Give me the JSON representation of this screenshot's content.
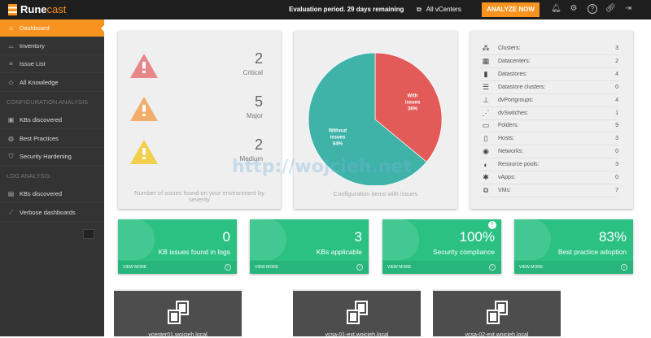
{
  "header": {
    "brand_a": "Rune",
    "brand_b": "cast",
    "evaluation": "Evaluation period. 29 days remaining",
    "vcenter_selector": "All vCenters",
    "analyze_label": "ANALYZE NOW",
    "icons": [
      "bell-icon",
      "gear-icon",
      "help-icon",
      "link-icon",
      "logout-icon"
    ]
  },
  "sidebar": {
    "items": [
      {
        "label": "Dashboard",
        "icon": "home-icon",
        "active": true
      },
      {
        "label": "Inventory",
        "icon": "inventory-icon"
      },
      {
        "label": "Issue List",
        "icon": "list-icon"
      },
      {
        "label": "All Knowledge",
        "icon": "diamond-icon"
      }
    ],
    "config_header": "CONFIGURATION ANALYSIS",
    "config_items": [
      {
        "label": "KBs discovered",
        "icon": "kb-icon"
      },
      {
        "label": "Best Practices",
        "icon": "globe-icon"
      },
      {
        "label": "Security Hardening",
        "icon": "shield-icon"
      }
    ],
    "log_header": "LOG ANALYSIS",
    "log_items": [
      {
        "label": "KBs discovered",
        "icon": "book-icon"
      },
      {
        "label": "Verbose dashboards",
        "icon": "chart-line-icon"
      }
    ]
  },
  "severity": {
    "items": [
      {
        "count": "2",
        "label": "Critical",
        "color": "#e8878a"
      },
      {
        "count": "5",
        "label": "Major",
        "color": "#f3ad6a"
      },
      {
        "count": "2",
        "label": "Medium",
        "color": "#f2d04c"
      }
    ],
    "caption": "Number of issues found on your environment by severity"
  },
  "chart_data": {
    "type": "pie",
    "title": "Configuration items with issues",
    "slices": [
      {
        "label": "With issues",
        "value": 36,
        "color": "#e35b59"
      },
      {
        "label": "Without issues",
        "value": 64,
        "color": "#3fb3a8"
      }
    ]
  },
  "inventory": [
    {
      "name": "Clusters:",
      "value": "3"
    },
    {
      "name": "Datacenters:",
      "value": "2"
    },
    {
      "name": "Datastores:",
      "value": "4"
    },
    {
      "name": "Datastore clusters:",
      "value": "0"
    },
    {
      "name": "dvPortgroups:",
      "value": "4"
    },
    {
      "name": "dvSwitches:",
      "value": "1"
    },
    {
      "name": "Folders:",
      "value": "9"
    },
    {
      "name": "Hosts:",
      "value": "3"
    },
    {
      "name": "Networks:",
      "value": "0"
    },
    {
      "name": "Resource pools:",
      "value": "3"
    },
    {
      "name": "vApps:",
      "value": "0"
    },
    {
      "name": "VMs:",
      "value": "7"
    }
  ],
  "tiles": [
    {
      "value": "0",
      "label": "KB issues found in logs",
      "more": "VIEW MORE"
    },
    {
      "value": "3",
      "label": "KBs applicable",
      "more": "VIEW MORE"
    },
    {
      "value": "100%",
      "label": "Security compliance",
      "more": "VIEW MORE",
      "alert": "!"
    },
    {
      "value": "83%",
      "label": "Best practice adoption",
      "more": "VIEW MORE"
    }
  ],
  "vcenters": [
    {
      "name": "vcenter01.wojcieh.local"
    },
    {
      "name": "vcsa-01-ext.wojcieh.local"
    },
    {
      "name": "vcsa-02-ext.wojcieh.local"
    }
  ],
  "watermark": "http://wojcieh.net"
}
